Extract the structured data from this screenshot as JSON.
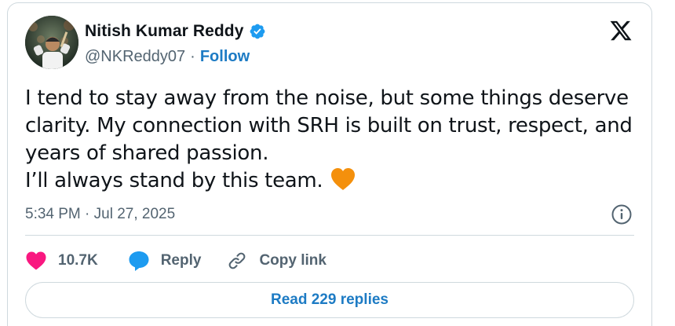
{
  "author": {
    "name": "Nitish Kumar Reddy",
    "handle": "@NKReddy07",
    "separator": "·",
    "follow_label": "Follow"
  },
  "tweet": {
    "lines": [
      "I tend to stay away from the noise, but some things deserve",
      "clarity. My connection with SRH is built on trust, respect, and",
      "years of shared passion.",
      "I’ll always stand by this team."
    ],
    "emoji": "orange-heart"
  },
  "timestamp": "5:34 PM · Jul 27, 2025",
  "actions": {
    "like_count": "10.7K",
    "reply_label": "Reply",
    "copy_link_label": "Copy link"
  },
  "read_replies_label": "Read 229 replies",
  "colors": {
    "like": "#f91880",
    "reply": "#1d9bf0",
    "link": "#1d7bc4",
    "secondary_text": "#536471",
    "emoji_heart": "#f4900c"
  },
  "icons": [
    "verified-badge-icon",
    "x-logo-icon",
    "info-icon",
    "heart-icon",
    "reply-bubble-icon",
    "link-icon"
  ]
}
